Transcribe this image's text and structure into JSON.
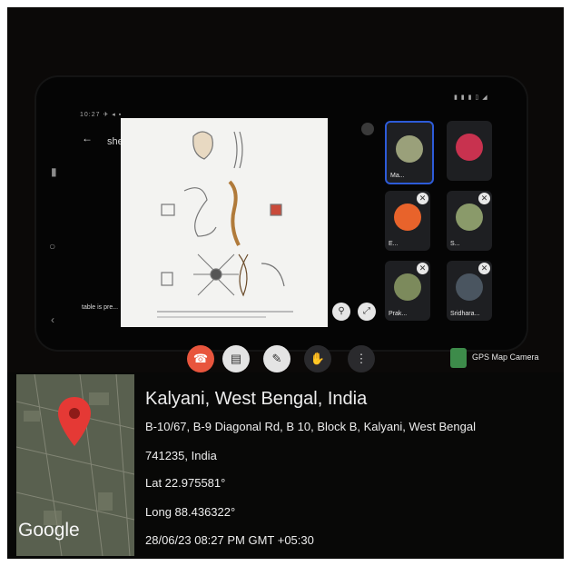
{
  "call": {
    "screen_title": "sheyaw বায়",
    "screen_caption": "table is pre...",
    "tiles": [
      {
        "label": "Ma...",
        "color": "#9aa07a"
      },
      {
        "label": "",
        "color": "#c8324f"
      },
      {
        "label": "E...",
        "color": "#e8632b"
      },
      {
        "label": "S...",
        "color": "#8a9a6a"
      },
      {
        "label": "Prak...",
        "color": "#7c8a5c"
      },
      {
        "label": "Sridhara...",
        "color": "#4a5560"
      }
    ],
    "controls": [
      {
        "name": "end-call",
        "glyph": "☎"
      },
      {
        "name": "chat",
        "glyph": "▤"
      },
      {
        "name": "mic",
        "glyph": "✎"
      },
      {
        "name": "raise-hand",
        "glyph": "✋"
      },
      {
        "name": "more",
        "glyph": "⋮"
      }
    ],
    "gps_label": "GPS Map Camera",
    "status_left": "10:27 ✈ ◂ ▪",
    "status_right": "▮ ▮ ▮ ▯ ◢"
  },
  "location": {
    "place": "Kalyani, West Bengal, India",
    "address_line1": "B-10/67, B-9 Diagonal Rd, B 10, Block B, Kalyani, West Bengal",
    "address_line2": "741235, India",
    "lat": "Lat 22.975581°",
    "long": "Long 88.436322°",
    "datetime": "28/06/23 08:27 PM GMT +05:30",
    "map_brand": "Google"
  },
  "colors": {
    "pin": "#e53935",
    "end_call": "#e8553d",
    "selected_tile_border": "#2d5bd8"
  }
}
